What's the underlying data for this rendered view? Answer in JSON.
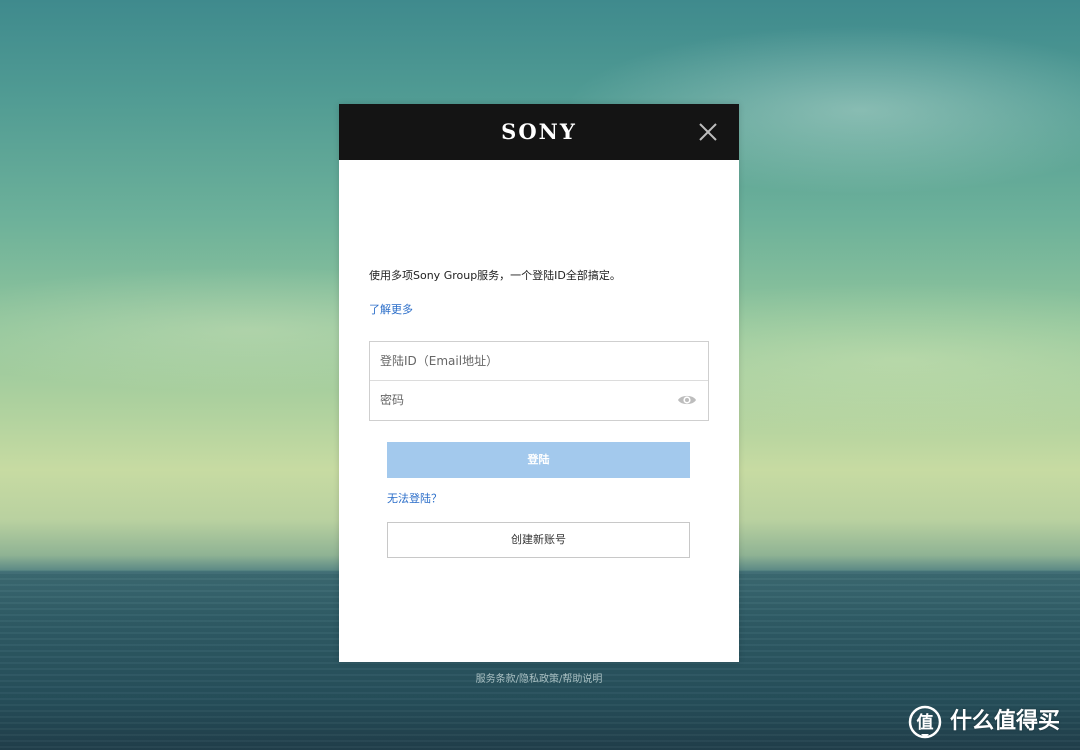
{
  "header": {
    "logo": "SONY",
    "close_icon": "close-icon"
  },
  "main": {
    "tagline": "使用多项Sony Group服务，一个登陆ID全部搞定。",
    "learn_more": "了解更多",
    "login_id": {
      "placeholder": "登陆ID（Email地址）",
      "value": ""
    },
    "password": {
      "placeholder": "密码",
      "value": "",
      "toggle_icon": "eye-icon"
    },
    "login_button": "登陆",
    "cannot_login": "无法登陆？",
    "create_account_button": "创建新账号"
  },
  "footer": {
    "terms": "服务条款",
    "separator": "/",
    "privacy": "隐私政策",
    "help": "帮助说明"
  },
  "watermark": {
    "badge_glyph": "值",
    "text": "什么值得买"
  },
  "colors": {
    "header_bg": "#141414",
    "login_button_bg": "#a3c9ed",
    "link": "#2b6ec9"
  }
}
